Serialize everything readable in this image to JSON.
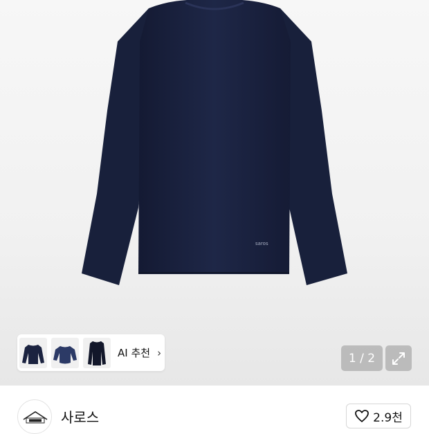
{
  "product_image": {
    "garment_label": "saros"
  },
  "ai_recommend": {
    "label": "AI 추천",
    "chevron": "›"
  },
  "pager": {
    "text": "1 / 2"
  },
  "icons": {
    "expand": "expand-icon",
    "heart": "heart-icon",
    "chevron": "chevron-right-icon"
  },
  "store": {
    "name": "사로스"
  },
  "like": {
    "count": "2.9천"
  },
  "colors": {
    "garment": "#1b2340",
    "hero_bg": "#f1f1f1",
    "pager_bg": "#9a9a9a"
  }
}
